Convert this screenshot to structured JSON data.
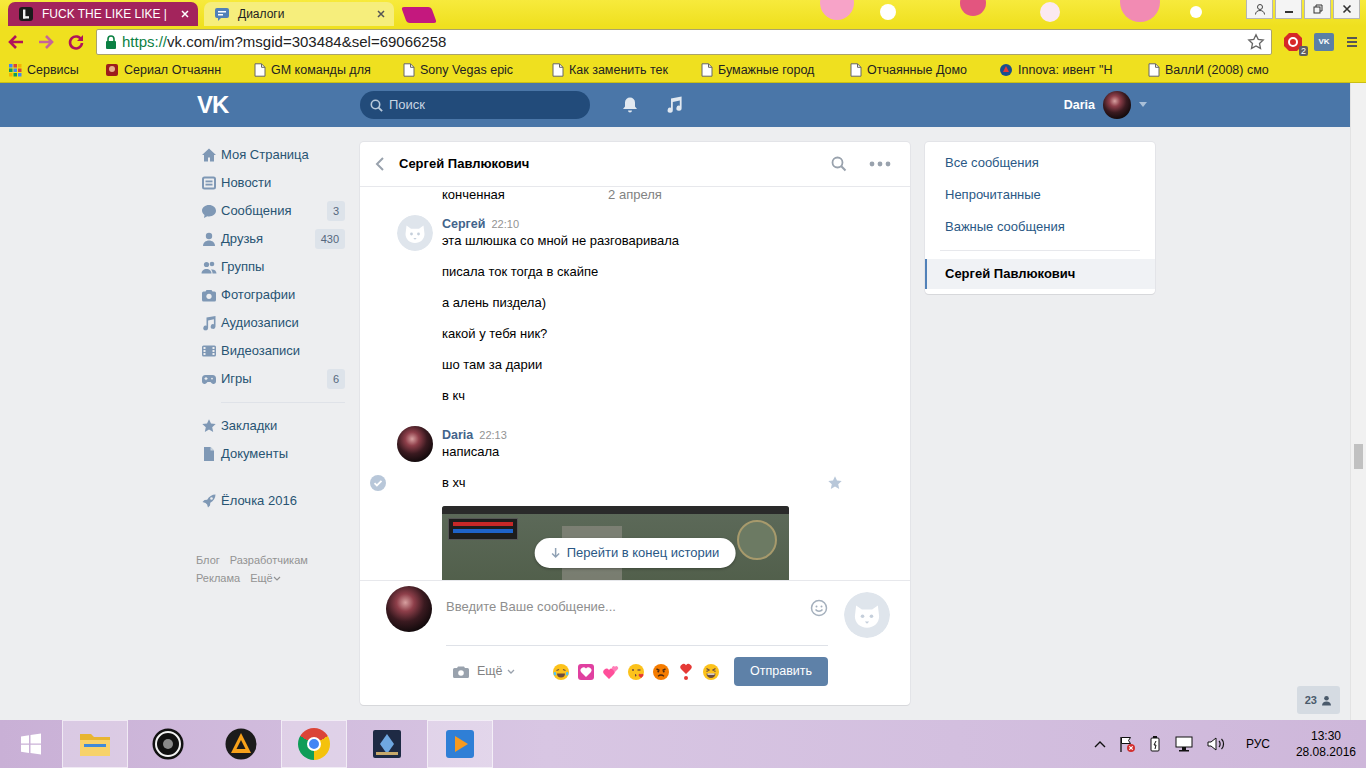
{
  "browser": {
    "tabs": [
      {
        "label": "FUCK THE LIKE LIKE |",
        "selected": false
      },
      {
        "label": "Диалоги",
        "selected": true
      }
    ],
    "address": {
      "scheme": "https://",
      "rest": "vk.com/im?msgid=303484&sel=69066258"
    },
    "ext_badge": "2",
    "vk_ext": "VK",
    "bookmarks": [
      "Сервисы",
      "Сериал Отчаянн",
      "GM команды для",
      "Sony Vegas epic",
      "Как заменить тек",
      "Бумажные город",
      "Отчаянные Домо",
      "Innova: ивент \"Н",
      "ВаллИ (2008) смо"
    ]
  },
  "vk": {
    "logo": "VK",
    "search": {
      "placeholder": "Поиск"
    },
    "user": {
      "name": "Daria"
    },
    "menu": [
      {
        "label": "Моя Страница"
      },
      {
        "label": "Новости"
      },
      {
        "label": "Сообщения",
        "badge": "3"
      },
      {
        "label": "Друзья",
        "badge": "430"
      },
      {
        "label": "Группы"
      },
      {
        "label": "Фотографии"
      },
      {
        "label": "Аудиозаписи"
      },
      {
        "label": "Видеозаписи"
      },
      {
        "label": "Игры",
        "badge": "6"
      }
    ],
    "menu_extra": [
      {
        "label": "Закладки"
      },
      {
        "label": "Документы"
      }
    ],
    "menu_apps": [
      {
        "label": "Ёлочка 2016"
      }
    ],
    "footer": [
      "Блог",
      "Разработчикам",
      "Реклама",
      "Ещё"
    ],
    "chat": {
      "title": "Сергей Павлюкович",
      "date": "2 апреля",
      "cut_text": "конченная",
      "groups": [
        {
          "author": "Сергей",
          "time": "22:10",
          "kind": "default",
          "lines": [
            {
              "text": "эта шлюшка со мной не разговаривала",
              "hovered": false
            },
            {
              "text": "писала ток тогда в скайпе",
              "hovered": false
            },
            {
              "text": "а алень пиздела)",
              "hovered": false
            },
            {
              "text": "какой у тебя ник?",
              "hovered": false
            },
            {
              "text": "шо там за дарии",
              "hovered": false
            },
            {
              "text": "в кч",
              "hovered": false
            }
          ]
        },
        {
          "author": "Daria",
          "time": "22:13",
          "kind": "photo",
          "lines": [
            {
              "text": "написала",
              "hovered": false
            },
            {
              "text": "в хч",
              "hovered": true
            }
          ],
          "attachment": {
            "kind": "image"
          }
        }
      ],
      "jump": "Перейти в конец истории",
      "input": {
        "placeholder": "Введите Ваше сообщение..."
      },
      "more": "Ещё",
      "send": "Отправить"
    },
    "folders": [
      {
        "label": "Все сообщения",
        "selected": false
      },
      {
        "label": "Непрочитанные",
        "selected": false
      },
      {
        "label": "Важные сообщения",
        "selected": false
      },
      {
        "label": "Сергей Павлюкович",
        "selected": true
      }
    ],
    "online": {
      "count": "23"
    }
  },
  "page_scroll": {
    "level": 0.59
  },
  "taskbar": {
    "apps": [
      {
        "running": true
      },
      {
        "running": false
      },
      {
        "running": false
      },
      {
        "running": true
      },
      {
        "running": false
      },
      {
        "running": true
      }
    ],
    "language": "РУС",
    "time": "13:30",
    "date": "28.08.2016"
  }
}
